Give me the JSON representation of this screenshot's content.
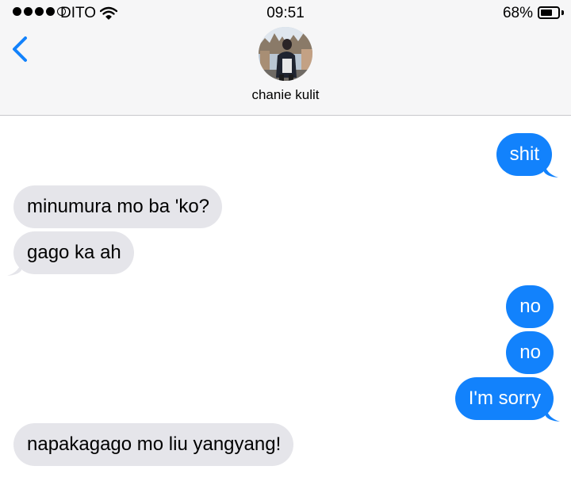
{
  "status_bar": {
    "carrier": "DITO",
    "time": "09:51",
    "battery_percent": "68%",
    "battery_level": 0.68,
    "signal_bars_filled": 4,
    "signal_bars_total": 5
  },
  "header": {
    "contact_name": "chanie kulit",
    "back_icon": "chevron-left-icon"
  },
  "messages": [
    {
      "direction": "sent",
      "text": "shit"
    },
    {
      "direction": "received",
      "text": "minumura mo ba 'ko?"
    },
    {
      "direction": "received",
      "text": "gago ka ah"
    },
    {
      "direction": "sent",
      "text": "no"
    },
    {
      "direction": "sent",
      "text": "no"
    },
    {
      "direction": "sent",
      "text": "I'm sorry"
    },
    {
      "direction": "received",
      "text": "napakagago mo liu yangyang!"
    }
  ],
  "colors": {
    "sent_bubble": "#1282fc",
    "received_bubble": "#e5e5ea",
    "accent": "#1282fc",
    "header_bg": "#f6f6f7"
  }
}
